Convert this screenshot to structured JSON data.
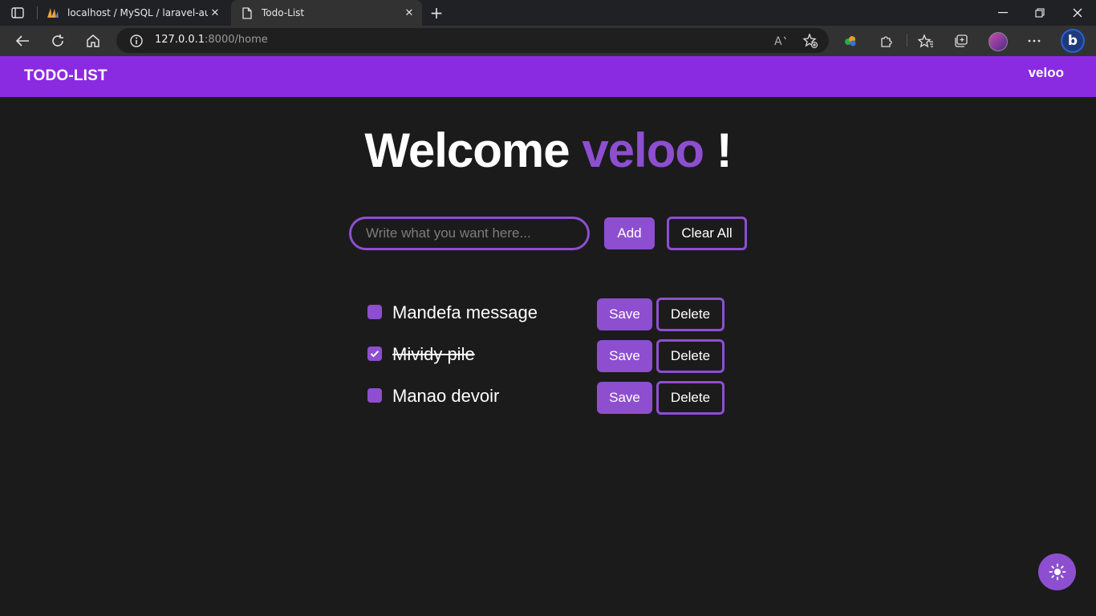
{
  "browser": {
    "tabs": [
      {
        "title": "localhost / MySQL / laravel-auth",
        "favicon": "phpmyadmin-icon",
        "active": false
      },
      {
        "title": "Todo-List",
        "favicon": "document-icon",
        "active": true
      }
    ],
    "url_host": "127.0.0.1",
    "url_rest": ":8000/home",
    "colors": {
      "tabbar": "#202124",
      "toolbar": "#323233",
      "omnibox": "#1f1f20"
    }
  },
  "navbar": {
    "brand": "TODO-LIST",
    "username": "veloo"
  },
  "welcome": {
    "prefix": "Welcome",
    "username": "veloo",
    "suffix": "!"
  },
  "form": {
    "placeholder": "Write what you want here...",
    "value": "",
    "add_label": "Add",
    "clear_label": "Clear All"
  },
  "todos": [
    {
      "text": "Mandefa message",
      "checked": false,
      "save_label": "Save",
      "delete_label": "Delete"
    },
    {
      "text": "Mividy pile",
      "checked": true,
      "save_label": "Save",
      "delete_label": "Delete"
    },
    {
      "text": "Manao devoir",
      "checked": false,
      "save_label": "Save",
      "delete_label": "Delete"
    }
  ],
  "theme_toggle": {
    "icon": "sun-icon"
  },
  "colors": {
    "accent": "#8d4fd0",
    "navbar": "#8a2be2",
    "background": "#1b1b1c"
  }
}
